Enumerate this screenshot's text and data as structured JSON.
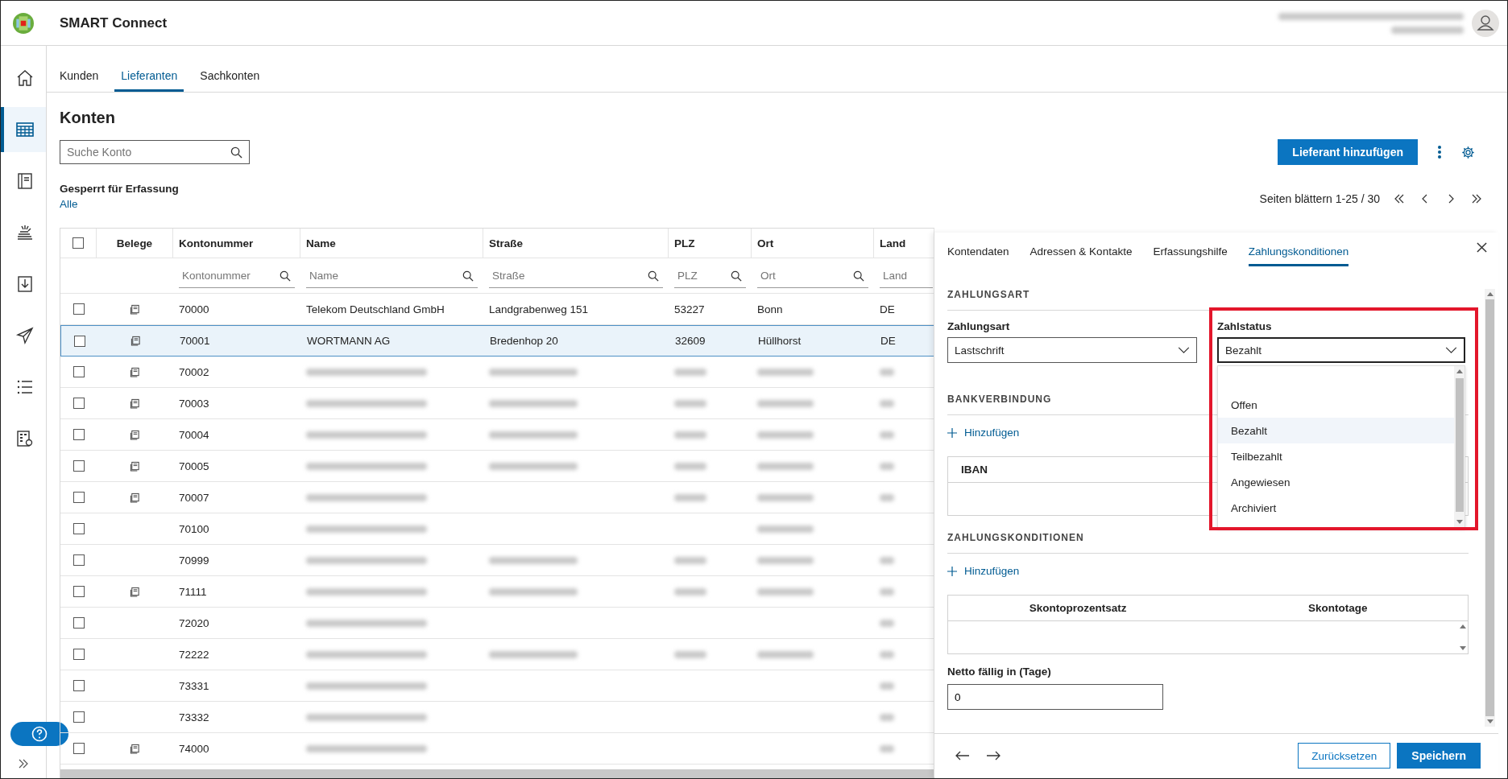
{
  "app": {
    "title": "SMART Connect"
  },
  "sidebar": {
    "items": [
      {
        "kind": "home",
        "selected": false
      },
      {
        "kind": "table",
        "selected": true
      },
      {
        "kind": "book",
        "selected": false
      },
      {
        "kind": "stack",
        "selected": false
      },
      {
        "kind": "download",
        "selected": false
      },
      {
        "kind": "send",
        "selected": false
      },
      {
        "kind": "list",
        "selected": false
      },
      {
        "kind": "gridgear",
        "selected": false
      }
    ]
  },
  "tabs": [
    {
      "label": "Kunden",
      "selected": false
    },
    {
      "label": "Lieferanten",
      "selected": true
    },
    {
      "label": "Sachkonten",
      "selected": false
    }
  ],
  "page": {
    "title": "Konten",
    "search": {
      "placeholder": "Suche Konto"
    },
    "filter": {
      "label": "Gesperrt für Erfassung",
      "value": "Alle"
    },
    "add_button": "Lieferant hinzufügen",
    "pagination": "Seiten blättern 1-25 / 30"
  },
  "table": {
    "all_checked": false,
    "columns": [
      {
        "label": "Belege"
      },
      {
        "label": "Kontonummer",
        "placeholder": "Kontonummer"
      },
      {
        "label": "Name",
        "placeholder": "Name"
      },
      {
        "label": "Straße",
        "placeholder": "Straße"
      },
      {
        "label": "PLZ",
        "placeholder": "PLZ"
      },
      {
        "label": "Ort",
        "placeholder": "Ort"
      },
      {
        "label": "Land",
        "placeholder": "Land"
      }
    ],
    "rows": [
      {
        "checked": false,
        "selected": false,
        "cells": [
          {
            "document": true
          },
          {
            "text": "70000"
          },
          {
            "text": "Telekom Deutschland GmbH"
          },
          {
            "text": "Landgrabenweg 151"
          },
          {
            "text": "53227"
          },
          {
            "text": "Bonn"
          },
          {
            "text": "DE"
          }
        ]
      },
      {
        "checked": false,
        "selected": true,
        "cells": [
          {
            "document": true
          },
          {
            "text": "70001"
          },
          {
            "text": "WORTMANN AG"
          },
          {
            "text": "Bredenhop 20"
          },
          {
            "text": "32609"
          },
          {
            "text": "Hüllhorst"
          },
          {
            "text": "DE"
          }
        ]
      },
      {
        "checked": false,
        "selected": false,
        "cells": [
          {
            "document": true
          },
          {
            "text": "70002"
          },
          {
            "blurred": true
          },
          {
            "blurred": true
          },
          {
            "blurred": true
          },
          {
            "blurred": true
          },
          {
            "blurred": true
          }
        ]
      },
      {
        "checked": false,
        "selected": false,
        "cells": [
          {
            "document": true
          },
          {
            "text": "70003"
          },
          {
            "blurred": true
          },
          {
            "blurred": true
          },
          {
            "blurred": true
          },
          {
            "blurred": true
          },
          {
            "blurred": true
          }
        ]
      },
      {
        "checked": false,
        "selected": false,
        "cells": [
          {
            "document": true
          },
          {
            "text": "70004"
          },
          {
            "blurred": true
          },
          {
            "blurred": true
          },
          {
            "blurred": true
          },
          {
            "blurred": true
          },
          {
            "blurred": true
          }
        ]
      },
      {
        "checked": false,
        "selected": false,
        "cells": [
          {
            "document": true
          },
          {
            "text": "70005"
          },
          {
            "blurred": true
          },
          {
            "blurred": true
          },
          {
            "blurred": true
          },
          {
            "blurred": true
          },
          {
            "blurred": true
          }
        ]
      },
      {
        "checked": false,
        "selected": false,
        "cells": [
          {
            "document": true
          },
          {
            "text": "70007"
          },
          {
            "blurred": true
          },
          null,
          {
            "blurred": true
          },
          {
            "blurred": true
          },
          {
            "blurred": true
          }
        ]
      },
      {
        "checked": false,
        "selected": false,
        "cells": [
          null,
          {
            "text": "70100"
          },
          {
            "blurred": true
          },
          null,
          null,
          {
            "blurred": true
          },
          null
        ]
      },
      {
        "checked": false,
        "selected": false,
        "cells": [
          null,
          {
            "text": "70999"
          },
          {
            "blurred": true
          },
          {
            "blurred": true
          },
          {
            "blurred": true
          },
          {
            "blurred": true
          },
          {
            "blurred": true
          }
        ]
      },
      {
        "checked": false,
        "selected": false,
        "cells": [
          {
            "document": true
          },
          {
            "text": "71111"
          },
          {
            "blurred": true
          },
          {
            "blurred": true
          },
          {
            "blurred": true
          },
          {
            "blurred": true
          },
          {
            "blurred": true
          }
        ]
      },
      {
        "checked": false,
        "selected": false,
        "cells": [
          null,
          {
            "text": "72020"
          },
          {
            "blurred": true
          },
          null,
          null,
          null,
          {
            "blurred": true
          }
        ]
      },
      {
        "checked": false,
        "selected": false,
        "cells": [
          null,
          {
            "text": "72222"
          },
          {
            "blurred": true
          },
          {
            "blurred": true
          },
          {
            "blurred": true
          },
          {
            "blurred": true
          },
          {
            "blurred": true
          }
        ]
      },
      {
        "checked": false,
        "selected": false,
        "cells": [
          null,
          {
            "text": "73331"
          },
          {
            "blurred": true
          },
          null,
          null,
          null,
          {
            "blurred": true
          }
        ]
      },
      {
        "checked": false,
        "selected": false,
        "cells": [
          null,
          {
            "text": "73332"
          },
          {
            "blurred": true
          },
          null,
          null,
          null,
          {
            "blurred": true
          }
        ]
      },
      {
        "checked": false,
        "selected": false,
        "cells": [
          {
            "document": true
          },
          {
            "text": "74000"
          },
          {
            "blurred": true
          },
          null,
          null,
          null,
          {
            "blurred": true
          }
        ]
      }
    ]
  },
  "panel": {
    "tabs": [
      {
        "label": "Kontendaten",
        "selected": false
      },
      {
        "label": "Adressen & Kontakte",
        "selected": false
      },
      {
        "label": "Erfassungshilfe",
        "selected": false
      },
      {
        "label": "Zahlungskonditionen",
        "selected": true
      }
    ],
    "zahlungsart": {
      "heading": "ZAHLUNGSART",
      "label": "Zahlungsart",
      "value": "Lastschrift"
    },
    "zahlstatus": {
      "label": "Zahlstatus",
      "value": "Bezahlt",
      "expanded": true,
      "highlighted": true,
      "options": [
        {
          "label": "Offen",
          "selected": false
        },
        {
          "label": "Bezahlt",
          "selected": true
        },
        {
          "label": "Teilbezahlt",
          "selected": false
        },
        {
          "label": "Angewiesen",
          "selected": false
        },
        {
          "label": "Archiviert",
          "selected": false
        }
      ]
    },
    "bankverbindung": {
      "heading": "BANKVERBINDUNG",
      "add_link": "Hinzufügen",
      "columns": [
        "IBAN"
      ]
    },
    "zahlungskonditionen": {
      "heading": "ZAHLUNGSKONDITIONEN",
      "add_link": "Hinzufügen",
      "columns": [
        "Skontoprozentsatz",
        "Skontotage"
      ]
    },
    "netto": {
      "label": "Netto fällig in (Tage)",
      "value": "0"
    },
    "buttons": {
      "reset": "Zurücksetzen",
      "save": "Speichern"
    }
  }
}
